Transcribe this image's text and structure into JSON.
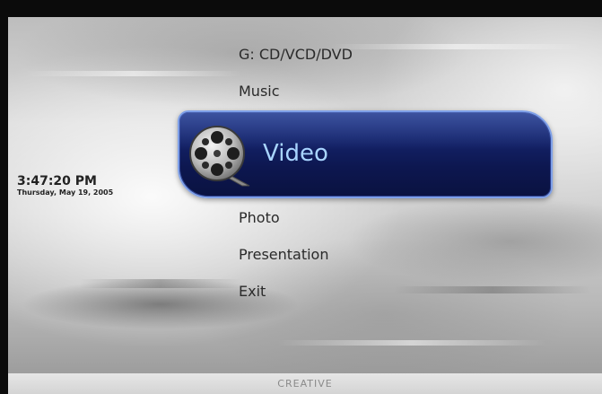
{
  "clock": {
    "time": "3:47:20 PM",
    "date": "Thursday, May 19, 2005"
  },
  "menu": {
    "items_above": [
      {
        "label": "G: CD/VCD/DVD"
      },
      {
        "label": "Music"
      }
    ],
    "selected": {
      "label": "Video",
      "icon": "film-reel-icon"
    },
    "items_below": [
      {
        "label": "Photo"
      },
      {
        "label": "Presentation"
      },
      {
        "label": "Exit"
      }
    ]
  },
  "footer": {
    "brand": "CREATIVE"
  },
  "colors": {
    "selection_fill": "#14236a",
    "selection_border": "#7fa0e8",
    "selected_text": "#a8d4ff"
  }
}
